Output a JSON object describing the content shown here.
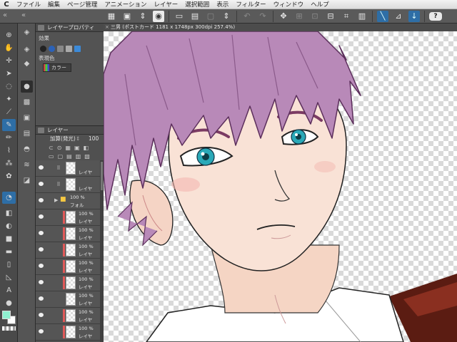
{
  "menubar": {
    "app_icon": "clip-studio-icon",
    "items": [
      "ファイル",
      "編集",
      "ページ管理",
      "アニメーション",
      "レイヤー",
      "選択範囲",
      "表示",
      "フィルター",
      "ウィンドウ",
      "ヘルプ"
    ]
  },
  "canvas": {
    "tab_title": "三男 (ポストカード 1181 x 1748px 300dpi 257.4%)"
  },
  "layer_property": {
    "title": "レイヤープロパティ",
    "effect_label": "効果",
    "expression_color_label": "表現色",
    "expression_color_value": "カラー"
  },
  "layer_panel": {
    "title": "レイヤー",
    "blend_mode": "加算(発光)",
    "opacity": "100",
    "layers": [
      {
        "pct": "",
        "name": "レイヤ",
        "type": "layer",
        "mark": false
      },
      {
        "pct": "",
        "name": "レイヤ",
        "type": "layer",
        "mark": false
      },
      {
        "pct": "100 %",
        "name": "フォル",
        "type": "folder",
        "mark": false
      },
      {
        "pct": "100 %",
        "name": "レイヤ",
        "type": "layer",
        "mark": true
      },
      {
        "pct": "100 %",
        "name": "レイヤ",
        "type": "layer",
        "mark": true
      },
      {
        "pct": "100 %",
        "name": "レイヤ",
        "type": "layer",
        "mark": true
      },
      {
        "pct": "100 %",
        "name": "レイヤ",
        "type": "layer",
        "mark": true
      },
      {
        "pct": "100 %",
        "name": "レイヤ",
        "type": "layer",
        "mark": true
      },
      {
        "pct": "100 %",
        "name": "レイヤ",
        "type": "layer",
        "mark": false
      },
      {
        "pct": "100 %",
        "name": "レイヤ",
        "type": "layer",
        "mark": true
      },
      {
        "pct": "100 %",
        "name": "レイヤ",
        "type": "layer",
        "mark": true
      }
    ]
  },
  "colors": {
    "main_color": "#8ff0d0",
    "sub_color": "#ffffff",
    "accent": "#2e6ea6"
  }
}
